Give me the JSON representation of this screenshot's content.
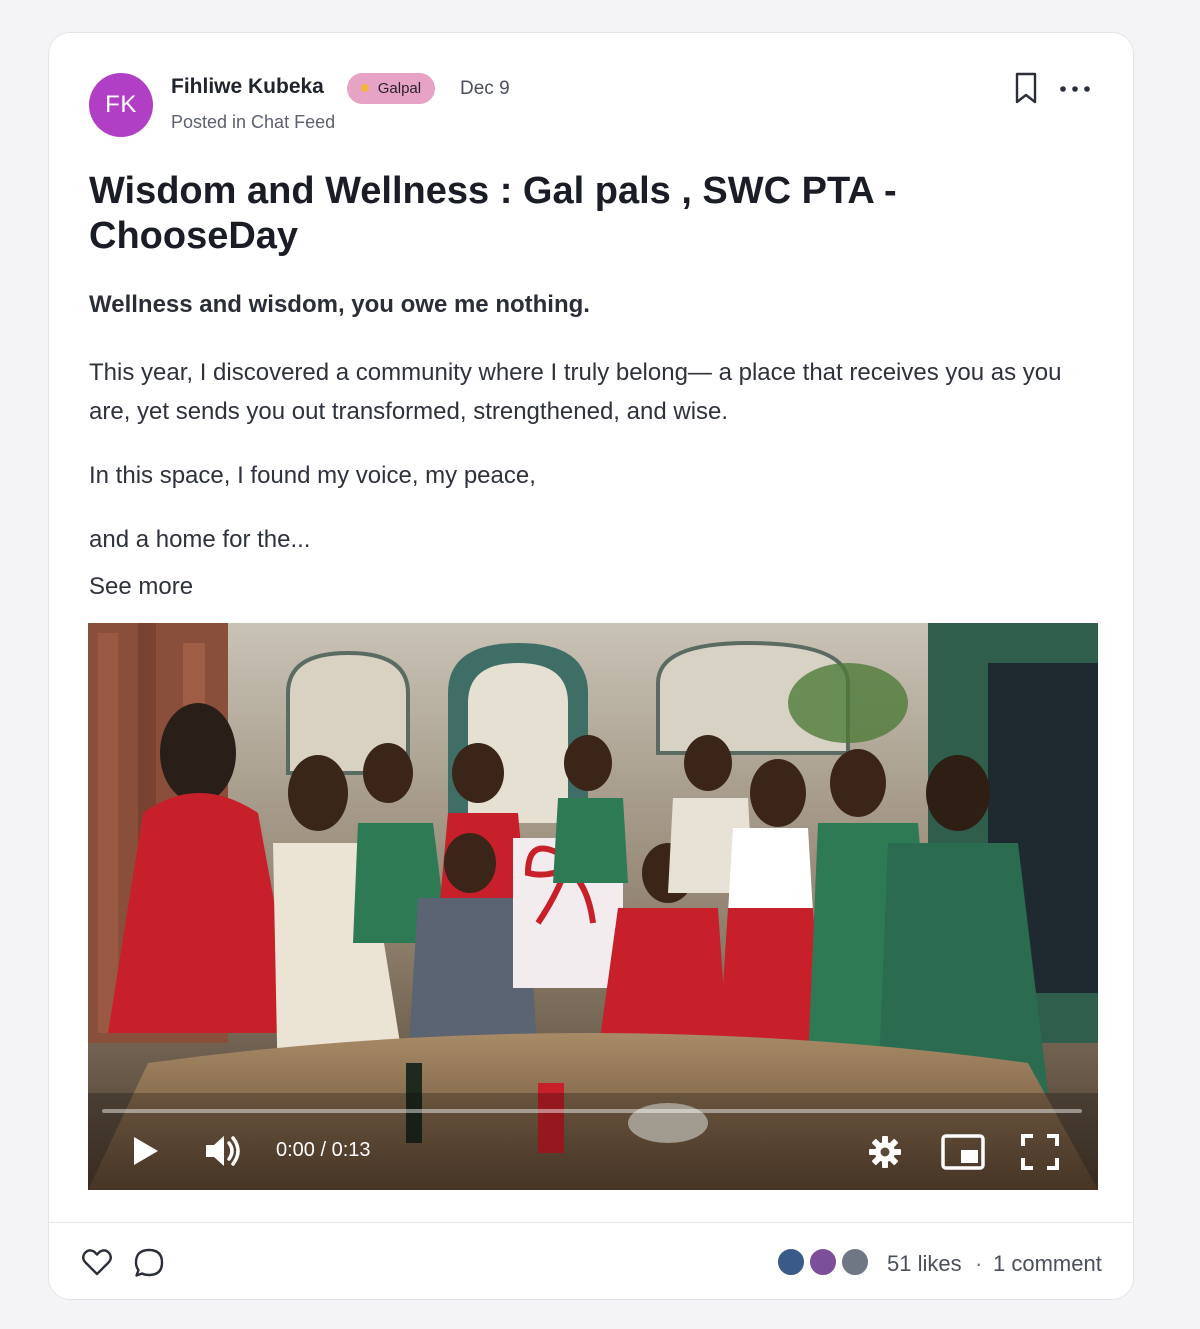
{
  "post": {
    "avatar_initials": "FK",
    "author": "Fihliwe Kubeka",
    "badge": "Galpal",
    "date": "Dec 9",
    "posted_in": "Posted in Chat Feed",
    "title": "Wisdom and Wellness : Gal pals , SWC PTA - ChooseDay",
    "lead": "Wellness and wisdom, you owe me nothing.",
    "paragraphs": [
      "This year, I discovered a community where I truly belong— a place that receives you as you are, yet sends you out transformed, strengthened, and wise.",
      "In this space, I found my voice, my peace,",
      "and a home for the..."
    ],
    "see_more": "See more"
  },
  "video": {
    "time": "0:00 / 0:13",
    "progress": 0,
    "controls": [
      "play-icon",
      "volume-icon",
      "settings-icon",
      "picture-in-picture-icon",
      "fullscreen-icon"
    ]
  },
  "footer": {
    "likes": "51 likes",
    "separator": "·",
    "comments": "1 comment",
    "icons": [
      "heart-icon",
      "comment-icon"
    ]
  },
  "colors": {
    "avatar": "#b03fc6",
    "badge": "#e6a3c5",
    "dress_red": "#c8202a",
    "dress_green": "#2d7a55"
  }
}
